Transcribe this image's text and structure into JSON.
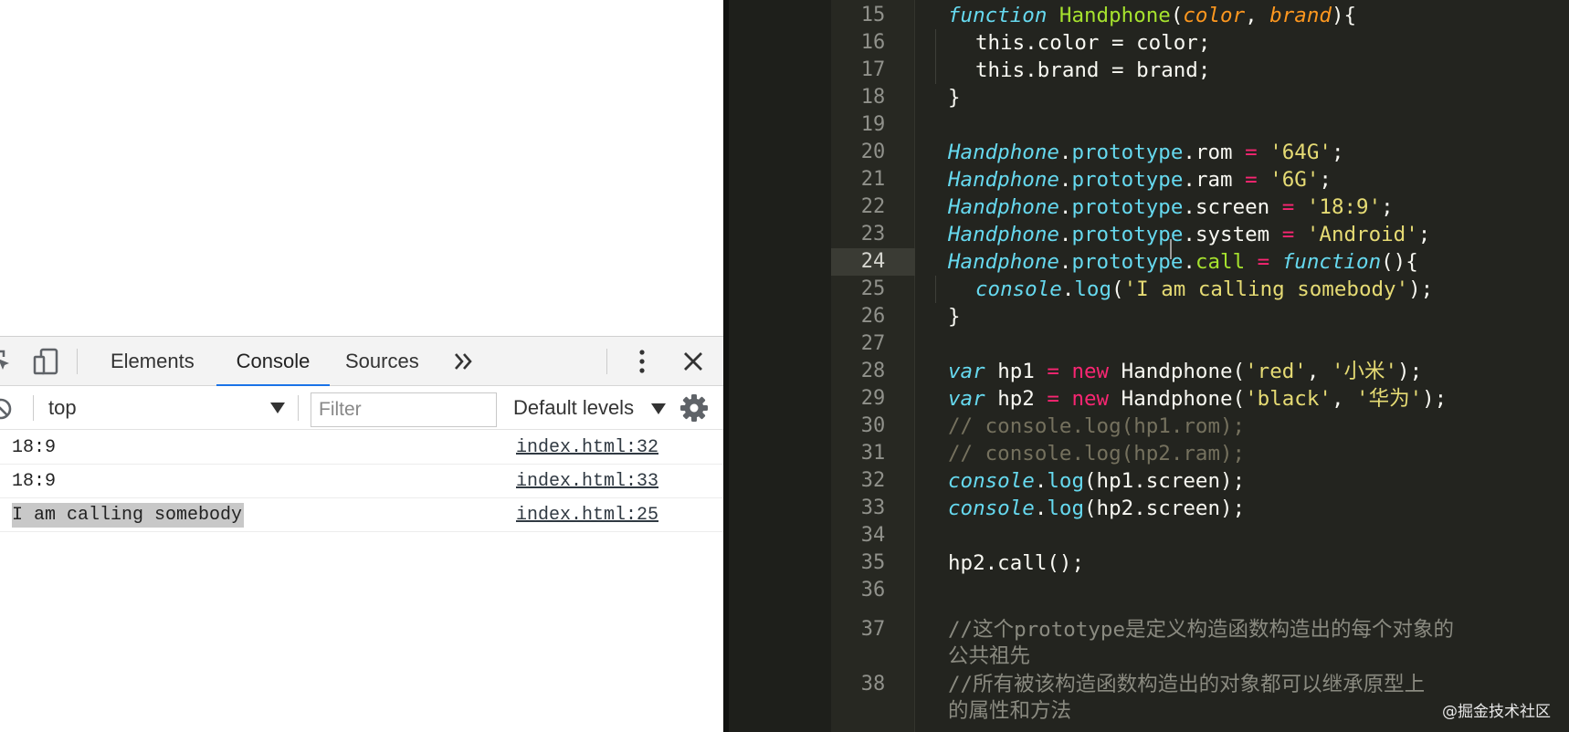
{
  "devtools": {
    "tabs": [
      {
        "label": "Elements"
      },
      {
        "label": "Console"
      },
      {
        "label": "Sources"
      }
    ],
    "overflow_glyph": "»",
    "filter_bar": {
      "context_value": "top",
      "filter_placeholder": "Filter",
      "levels_label": "Default levels"
    },
    "console_messages": [
      {
        "message": "18:9",
        "source": "index.html:32"
      },
      {
        "message": "18:9",
        "source": "index.html:33"
      },
      {
        "message": "I am calling somebody",
        "source": "index.html:25"
      }
    ]
  },
  "editor": {
    "active_line": 24,
    "line_numbers": [
      "15",
      "16",
      "17",
      "18",
      "19",
      "20",
      "21",
      "22",
      "23",
      "24",
      "25",
      "26",
      "27",
      "28",
      "29",
      "30",
      "31",
      "32",
      "33",
      "34",
      "35",
      "36",
      "37",
      "38"
    ],
    "lines": {
      "l15": {
        "kw": "function",
        "name": "Handphone",
        "p1": "color",
        "p2": "brand"
      },
      "l16": "this.color = color;",
      "l17": "this.brand = brand;",
      "l18": "}",
      "l20": {
        "obj": "Handphone",
        "proto": "prototype",
        "prop": "rom",
        "val": "'64G'"
      },
      "l21": {
        "obj": "Handphone",
        "proto": "prototype",
        "prop": "ram",
        "val": "'6G'"
      },
      "l22": {
        "obj": "Handphone",
        "proto": "prototype",
        "prop": "screen",
        "val": "'18:9'"
      },
      "l23": {
        "obj": "Handphone",
        "proto": "prototype",
        "prop": "system",
        "val": "'Android'"
      },
      "l24": {
        "obj": "Handphone",
        "proto": "prototype",
        "prop": "call",
        "kw": "function"
      },
      "l25": {
        "obj": "console",
        "method": "log",
        "val": "'I am calling somebody'"
      },
      "l26": "}",
      "l28": {
        "kw": "var",
        "name": "hp1",
        "new": "new",
        "ctor": "Handphone",
        "a1": "'red'",
        "a2": "'小米'"
      },
      "l29": {
        "kw": "var",
        "name": "hp2",
        "new": "new",
        "ctor": "Handphone",
        "a1": "'black'",
        "a2": "'华为'"
      },
      "l30": "// console.log(hp1.rom);",
      "l31": "// console.log(hp2.ram);",
      "l32": {
        "obj": "console",
        "method": "log",
        "arg": "(hp1.screen);"
      },
      "l33": {
        "obj": "console",
        "method": "log",
        "arg": "(hp2.screen);"
      },
      "l35": "hp2.call();",
      "l37a": "//这个prototype是定义构造函数构造出的每个对象的",
      "l37b": "公共祖先",
      "l38a": "//所有被该构造函数构造出的对象都可以继承原型上",
      "l38b": "的属性和方法"
    }
  },
  "watermark": "@掘金技术社区",
  "colors": {
    "editor_bg": "#272822",
    "keyword": "#66d9ef",
    "function_name": "#a6e22e",
    "param": "#fd971f",
    "operator": "#f92672",
    "string": "#e6db74",
    "comment": "#75715e",
    "devtools_tab_underline": "#1a73e8"
  }
}
